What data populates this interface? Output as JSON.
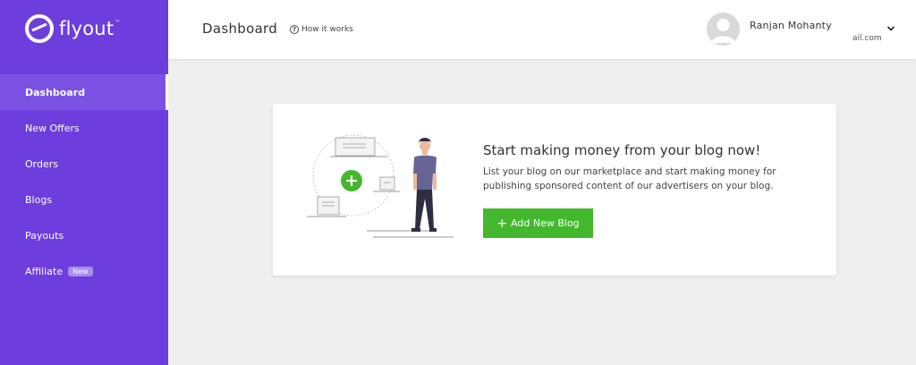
{
  "brand": {
    "name": "flyout",
    "tm": "™"
  },
  "sidebar": {
    "items": [
      {
        "label": "Dashboard",
        "active": true
      },
      {
        "label": "New Offers"
      },
      {
        "label": "Orders"
      },
      {
        "label": "Blogs"
      },
      {
        "label": "Payouts"
      },
      {
        "label": "Affiliate",
        "badge": "New"
      }
    ]
  },
  "header": {
    "title": "Dashboard",
    "how_it_works": "How it works",
    "user_name": "Ranjan Mohanty",
    "user_email_partial": "ail.com"
  },
  "card": {
    "title": "Start making money from your blog now!",
    "description": "List your blog on our marketplace and start making money for publishing sponsored content of our advertisers on your blog.",
    "button_label": "Add New Blog"
  },
  "colors": {
    "sidebar": "#6d3ddd",
    "active": "#7c52e4",
    "button": "#44b82c"
  }
}
